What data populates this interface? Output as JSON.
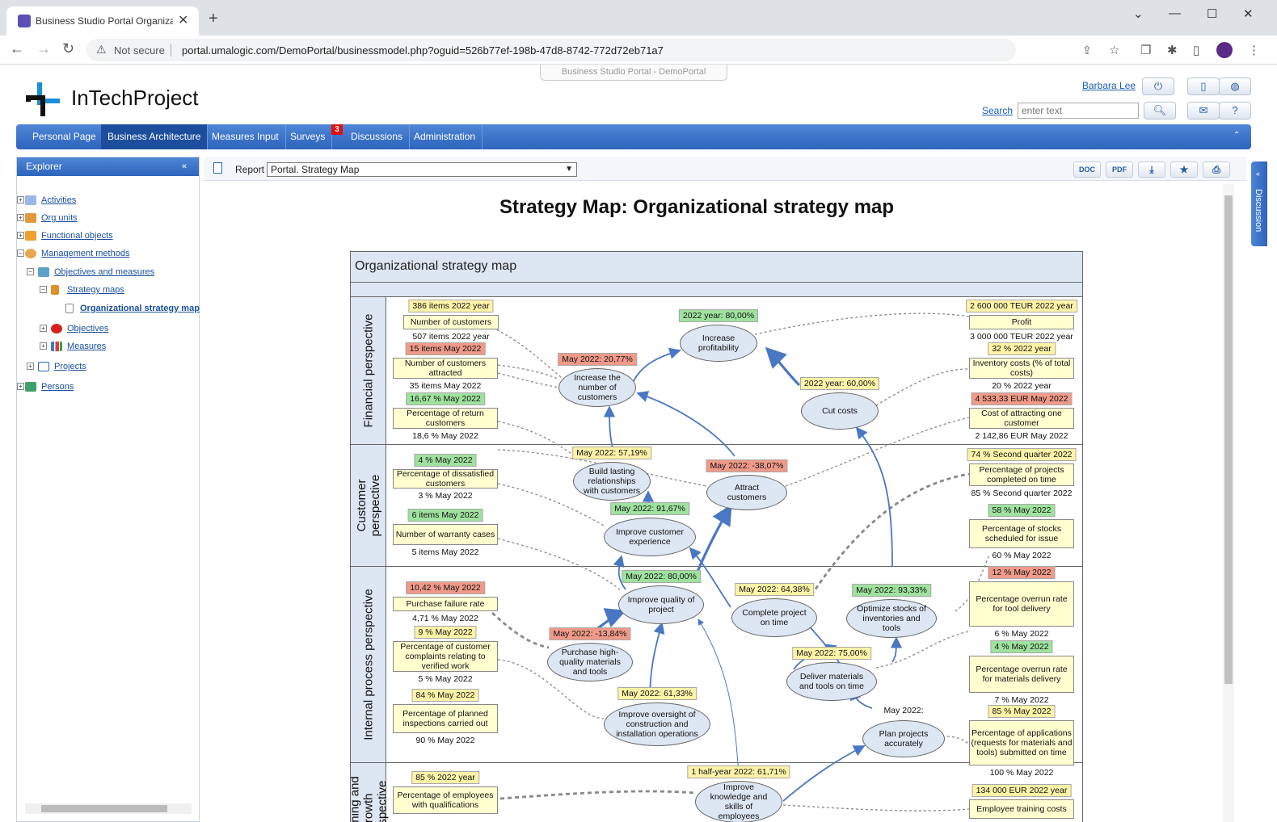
{
  "browser": {
    "tab_title": "Business Studio Portal Organizati",
    "not_secure": "Not secure",
    "url": "portal.umalogic.com/DemoPortal/businessmodel.php?oguid=526b77ef-198b-47d8-8742-772d72eb71a7"
  },
  "portal": {
    "tag": "Business Studio Portal - DemoPortal",
    "logo": "InTechProject",
    "user": "Barbara Lee",
    "search_label": "Search",
    "search_placeholder": "enter text"
  },
  "menu": {
    "items": [
      "Personal Page",
      "Business Architecture",
      "Measures Input",
      "Surveys",
      "Discussions",
      "Administration"
    ],
    "surveys_badge": "3"
  },
  "explorer": {
    "title": "Explorer",
    "items": [
      "Activities",
      "Org units",
      "Functional objects",
      "Management methods",
      "Objectives and measures",
      "Strategy maps",
      "Organizational strategy map",
      "Objectives",
      "Measures",
      "Projects",
      "Persons"
    ]
  },
  "report": {
    "label": "Report",
    "selected": "Portal. Strategy Map",
    "buttons": [
      "DOC",
      "PDF"
    ],
    "discussion": "Discussion"
  },
  "map": {
    "page_title": "Strategy Map: Organizational strategy map",
    "header": "Organizational strategy map",
    "lanes": [
      "Financial perspective",
      "Customer perspective",
      "Internal process perspective",
      "Learning and growth perspective"
    ],
    "measures": [
      {
        "top": "386 items 2022 year",
        "name": "Number of customers",
        "bottom": "507 items 2022 year",
        "color": "yellow"
      },
      {
        "top": "15 items May 2022",
        "name": "Number of customers attracted",
        "bottom": "35 items May 2022",
        "color": "red"
      },
      {
        "top": "16,67 % May 2022",
        "name": "Percentage of return customers",
        "bottom": "18,6 % May 2022",
        "color": "green"
      },
      {
        "top": "4 % May 2022",
        "name": "Percentage of dissatisfied customers",
        "bottom": "3 % May 2022",
        "color": "green"
      },
      {
        "top": "6 items May 2022",
        "name": "Number of warranty cases",
        "bottom": "5 items May 2022",
        "color": "green"
      },
      {
        "top": "10,42 % May 2022",
        "name": "Purchase failure rate",
        "bottom": "4,71 % May 2022",
        "color": "red"
      },
      {
        "top": "9 % May 2022",
        "name": "Percentage of customer complaints relating to verified work",
        "bottom": "5 % May 2022",
        "color": "yellow"
      },
      {
        "top": "84 % May 2022",
        "name": "Percentage of planned inspections carried out",
        "bottom": "90 % May 2022",
        "color": "yellow"
      },
      {
        "top": "85 % 2022 year",
        "name": "Percentage of employees with qualifications",
        "bottom": "",
        "color": "yellow"
      },
      {
        "top": "2 600 000 TEUR 2022 year",
        "name": "Profit",
        "bottom": "3 000 000 TEUR 2022 year",
        "color": "yellow"
      },
      {
        "top": "32 % 2022 year",
        "name": "Inventory costs (% of total costs)",
        "bottom": "20 % 2022 year",
        "color": "yellow"
      },
      {
        "top": "4 533,33 EUR May 2022",
        "name": "Cost of attracting one customer",
        "bottom": "2 142,86 EUR May 2022",
        "color": "red"
      },
      {
        "top": "74 % Second quarter 2022",
        "name": "Percentage of projects completed on time",
        "bottom": "85 % Second quarter 2022",
        "color": "yellow"
      },
      {
        "top": "58 % May 2022",
        "name": "Percentage of stocks scheduled for issue",
        "bottom": "60 % May 2022",
        "color": "green"
      },
      {
        "top": "12 % May 2022",
        "name": "Percentage overrun rate for tool delivery",
        "bottom": "6 % May 2022",
        "color": "red"
      },
      {
        "top": "4 % May 2022",
        "name": "Percentage overrun rate for materials delivery",
        "bottom": "7 % May 2022",
        "color": "green"
      },
      {
        "top": "85 % May 2022",
        "name": "Percentage of applications (requests for materials and tools) submitted on time",
        "bottom": "100 % May 2022",
        "color": "yellow"
      },
      {
        "top": "134 000 EUR 2022 year",
        "name": "Employee training costs",
        "bottom": "",
        "color": "yellow"
      }
    ],
    "objectives": [
      {
        "name": "Increase profitability",
        "tag": "2022 year: 80,00%",
        "color": "green"
      },
      {
        "name": "Increase the number of customers",
        "tag": "May 2022: 20,77%",
        "color": "red"
      },
      {
        "name": "Cut costs",
        "tag": "2022 year: 60,00%",
        "color": "yellow"
      },
      {
        "name": "Build lasting relationships with customers",
        "tag": "May 2022: 57,19%",
        "color": "yellow"
      },
      {
        "name": "Attract customers",
        "tag": "May 2022: -38,07%",
        "color": "red"
      },
      {
        "name": "Improve customer experience",
        "tag": "May 2022: 91,67%",
        "color": "green"
      },
      {
        "name": "Improve quality of project",
        "tag": "May 2022: 80,00%",
        "color": "green"
      },
      {
        "name": "Complete project on time",
        "tag": "May 2022: 64,38%",
        "color": "yellow"
      },
      {
        "name": "Optimize stocks of inventories and tools",
        "tag": "May 2022: 93,33%",
        "color": "green"
      },
      {
        "name": "Purchase high-quality materials and tools",
        "tag": "May 2022: -13,84%",
        "color": "red"
      },
      {
        "name": "Deliver materials and tools on time",
        "tag": "May 2022: 75,00%",
        "color": "yellow"
      },
      {
        "name": "Improve oversight of construction and installation operations",
        "tag": "May 2022: 61,33%",
        "color": "yellow"
      },
      {
        "name": "Plan projects accurately",
        "tag": "May 2022:",
        "color": "none"
      },
      {
        "name": "Improve knowledge and skills of employees",
        "tag": "1 half-year 2022: 61,71%",
        "color": "yellow"
      }
    ]
  },
  "colors": {
    "menu": "#2d64bd",
    "yellow": "#fff3a8",
    "green": "#9fe29f",
    "red": "#f09a8a",
    "node": "#dde6f3",
    "link": "#4a77c4"
  }
}
